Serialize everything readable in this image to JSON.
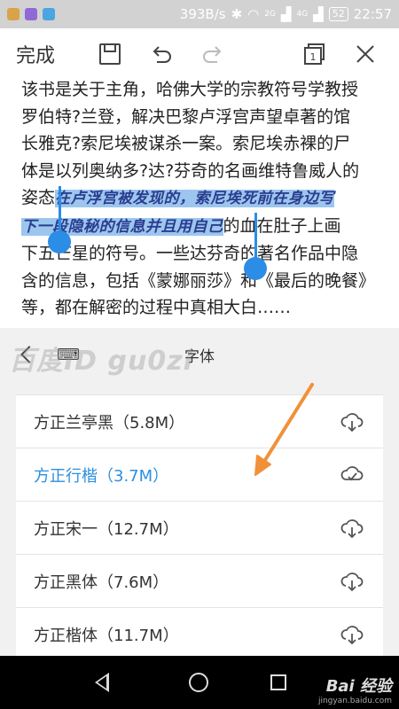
{
  "status_bar": {
    "speed": "393B/s",
    "signal_1": "2G",
    "signal_2": "4G",
    "battery": "52",
    "time": "22:57",
    "app_icon_colors": [
      "#d9a34a",
      "#8f6ad6",
      "#4aa5e0"
    ]
  },
  "toolbar": {
    "done_label": "完成",
    "tab_count": "1",
    "icons": [
      "save-icon",
      "undo-icon",
      "redo-icon",
      "tabs-icon",
      "close-icon"
    ]
  },
  "content": {
    "line1": "该书是关于主角，哈佛大学的宗教符号学教授",
    "line2": "罗伯特?兰登，解决巴黎卢浮宫声望卓著的馆",
    "line3": "长雅克?索尼埃被谋杀一案。索尼埃赤裸的尸",
    "line4": "体是以列奥纳多?达?芬奇的名画维特鲁威人的",
    "line5_pre": "姿态",
    "line5_sel": "在卢浮宫被发现的，索尼埃死前在身边写",
    "line6_sel": "下一段隐秘的信息并且用自己",
    "line6_post": "的血在肚子上画",
    "line7": "下五芒星的符号。一些达芬奇的著名作品中隐",
    "line8": "含的信息，包括《蒙娜丽莎》和《最后的晚餐》",
    "line9": "等，都在解密的过程中真相大白……"
  },
  "font_panel": {
    "title": "字体",
    "watermark": "百度ID gu0zi",
    "fonts": [
      {
        "label": "方正兰亭黑（5.8M）",
        "active": false
      },
      {
        "label": "方正行楷（3.7M）",
        "active": true
      },
      {
        "label": "方正宋一（12.7M）",
        "active": false
      },
      {
        "label": "方正黑体（7.6M）",
        "active": false
      },
      {
        "label": "方正楷体（11.7M）",
        "active": false
      }
    ]
  },
  "colors": {
    "accent": "#2b8fe0",
    "selection": "#9dc6ee",
    "arrow": "#f0913a"
  },
  "nav_watermark": {
    "logo": "Bai 经验",
    "url": "jingyan.baidu.com"
  }
}
